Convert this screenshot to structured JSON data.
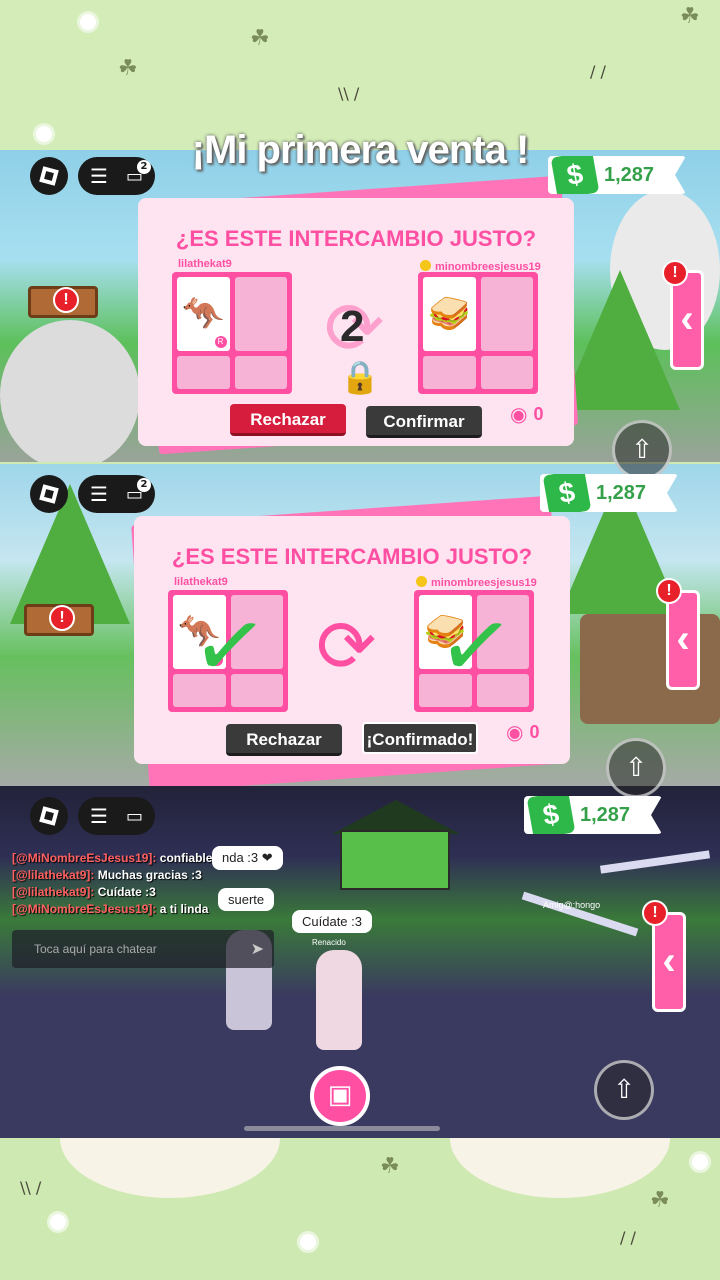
{
  "video_title": "¡Mi primera venta !",
  "money": "1,287",
  "money_symbol": "$",
  "chat_badge": "2",
  "trade_title": "¿ES ESTE INTERCAMBIO JUSTO?",
  "player_left": "lilathekat9",
  "player_right": "minombreesjesus19",
  "countdown": "2",
  "reject_label": "Rechazar",
  "confirm_label": "Confirmar",
  "confirmed_label": "¡Confirmado!",
  "viewers": "0",
  "rare_tag": "R",
  "alert": "!",
  "items": {
    "left": "kangaroo-pet",
    "right": "sandwich"
  },
  "chat": {
    "lines": [
      {
        "user": "[@MiNombreEsJesus19]:",
        "text": "confiable"
      },
      {
        "user": "[@lilathekat9]:",
        "text": "Muchas gracias :3"
      },
      {
        "user": "[@lilathekat9]:",
        "text": "Cuídate :3"
      },
      {
        "user": "[@MiNombreEsJesus19]:",
        "text": "a ti linda"
      }
    ],
    "placeholder": "Toca aquí para chatear"
  },
  "bubbles": {
    "b1": "nda :3 ❤",
    "b2": "suerte",
    "b3": "Cuídate :3"
  },
  "world_labels": {
    "name_under_player": "Renacido",
    "sign": "Amig@:hongo"
  },
  "icons": {
    "roblox": "roblox-logo-icon",
    "menu": "hamburger-icon",
    "chat": "chat-icon",
    "eye": "eye-icon",
    "lock": "lock-icon",
    "swap": "swap-arrows-icon",
    "jump": "jump-arrow-icon",
    "backpack": "backpack-icon",
    "send": "send-icon"
  },
  "colors": {
    "pink": "#ff4fa3",
    "green": "#35a04a",
    "reject": "#d61d3d"
  }
}
